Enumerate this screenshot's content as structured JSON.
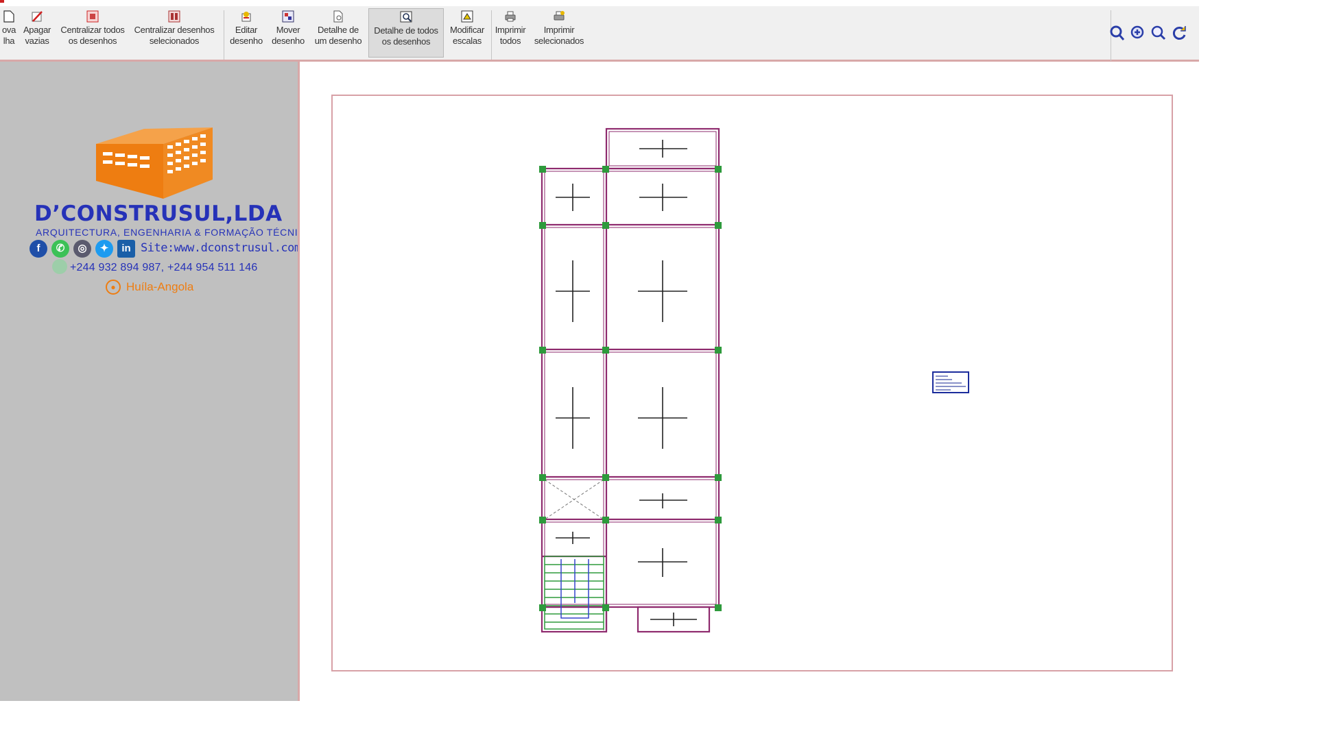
{
  "window": {
    "title_text": ""
  },
  "toolbar": {
    "buttons": [
      {
        "label": "ova\nlha",
        "icon": "new-sheet-icon"
      },
      {
        "label": "Apagar\nvazias",
        "icon": "erase-icon"
      },
      {
        "label": "Centralizar todos\nos desenhos",
        "icon": "center-all-icon"
      },
      {
        "label": "Centralizar desenhos\nselecionados",
        "icon": "center-selected-icon"
      },
      {
        "label": "Editar\ndesenho",
        "icon": "edit-drawing-icon"
      },
      {
        "label": "Mover\ndesenho",
        "icon": "move-drawing-icon"
      },
      {
        "label": "Detalhe de\num desenho",
        "icon": "detail-one-icon"
      },
      {
        "label": "Detalhe de todos\nos desenhos",
        "icon": "detail-all-icon",
        "active": true
      },
      {
        "label": "Modificar\nescalas",
        "icon": "modify-scale-icon"
      },
      {
        "label": "Imprimir\ntodos",
        "icon": "print-all-icon"
      },
      {
        "label": "Imprimir\nselecionados",
        "icon": "print-selected-icon"
      }
    ],
    "right_icons": [
      "zoom-window-icon",
      "zoom-all-icon",
      "zoom-icon",
      "refresh-icon"
    ]
  },
  "logo": {
    "name": "D’CONSTRUSUL,LDA",
    "tagline": "ARQUITECTURA, ENGENHARIA & FORMAÇÃO TÉCNICA",
    "site": "Site:www.dconstrusul.com",
    "phone": "+244 932 894 987, +244 954 511 146",
    "location": "Huíla-Angola",
    "social_icons": [
      "facebook-icon",
      "whatsapp-icon",
      "instagram-icon",
      "twitter-icon",
      "linkedin-icon"
    ],
    "brand_orange": "#ee7d11",
    "brand_blue": "#2632b8"
  },
  "colors": {
    "beam": "#8e2a6e",
    "column": "#2e9a3c",
    "sheet_border": "#d7a0a6",
    "legend_border": "#1b2c9c"
  }
}
